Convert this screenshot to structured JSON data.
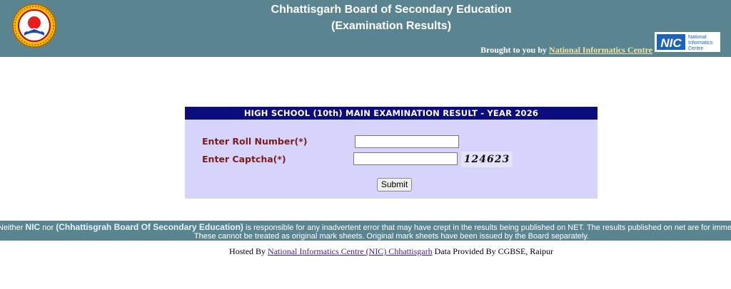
{
  "header": {
    "title_line1": "Chhattisgarh Board of Secondary Education",
    "title_line2": "(Examination Results)",
    "brought_prefix": "Brought to you by",
    "brought_link": "National Informatics Centre",
    "nic_logo": {
      "abbr": "NIC",
      "text_lines": [
        "National",
        "Informatics",
        "Centre"
      ]
    }
  },
  "form": {
    "heading": "HIGH SCHOOL (10th) MAIN  EXAMINATION RESULT - YEAR 2026",
    "roll_label": "Enter Roll Number(*)",
    "roll_value": "",
    "captcha_label": "Enter Captcha(*)",
    "captcha_value": "",
    "captcha_code": "124623",
    "submit_label": "Submit"
  },
  "disclaimer": {
    "part1": "Neither",
    "nic": "NIC",
    "part2": "nor",
    "board": "(Chhattisgrah Board Of Secondary Education)",
    "part3": "is responsible for any inadvertent error that may have crept in the results being published on NET. The results published on net are for immediate information",
    "line2": "These cannot be treated as original mark sheets. Original mark sheets have been issued by the Board separately."
  },
  "footer": {
    "hosted_prefix": "Hosted By",
    "hosted_link": "National Informatics Centre (NIC) Chhattisgarh",
    "data_provided": "Data Provided By CGBSE, Raipur"
  },
  "colors": {
    "header_bg": "#5b8491",
    "panel_bg": "#d6d4fb",
    "panel_head_bg": "#0c0c7a",
    "label_color": "#7b1c1c",
    "link_color": "#3e1d8f"
  }
}
